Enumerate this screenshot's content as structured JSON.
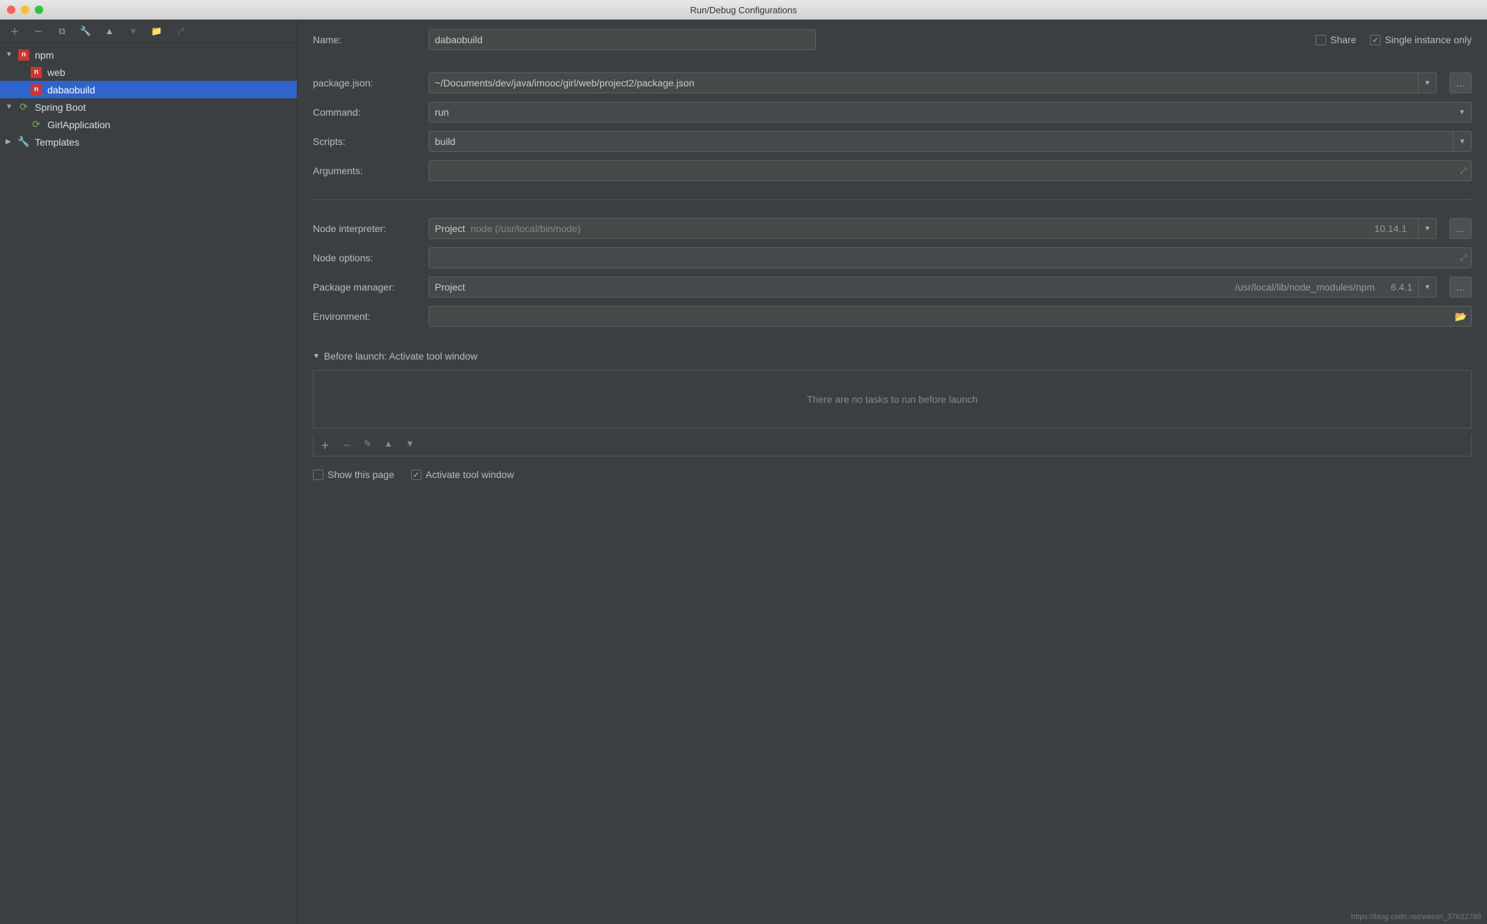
{
  "titlebar": {
    "title": "Run/Debug Configurations"
  },
  "toolbar_icons": [
    "+",
    "−"
  ],
  "tree": {
    "nodes": [
      {
        "label": "npm",
        "icon": "npm",
        "expanded": true,
        "children": [
          {
            "label": "web",
            "icon": "npm"
          },
          {
            "label": "dabaobuild",
            "icon": "npm",
            "selected": true
          }
        ]
      },
      {
        "label": "Spring Boot",
        "icon": "spring",
        "expanded": true,
        "children": [
          {
            "label": "GirlApplication",
            "icon": "spring"
          }
        ]
      },
      {
        "label": "Templates",
        "icon": "wrench",
        "expanded": false
      }
    ]
  },
  "form": {
    "name_label": "Name:",
    "name_value": "dabaobuild",
    "share_label": "Share",
    "share_checked": false,
    "single_instance_label": "Single instance only",
    "single_instance_checked": true,
    "package_json_label": "package.json:",
    "package_json_value": "~/Documents/dev/java/imooc/girl/web/project2/package.json",
    "command_label": "Command:",
    "command_value": "run",
    "scripts_label": "Scripts:",
    "scripts_value": "build",
    "arguments_label": "Arguments:",
    "arguments_value": "",
    "node_interpreter_label": "Node interpreter:",
    "node_interpreter_prefix": "Project",
    "node_interpreter_path": "node (/usr/local/bin/node)",
    "node_interpreter_version": "10.14.1",
    "node_options_label": "Node options:",
    "node_options_value": "",
    "package_manager_label": "Package manager:",
    "package_manager_prefix": "Project",
    "package_manager_path": "/usr/local/lib/node_modules/npm",
    "package_manager_version": "6.4.1",
    "environment_label": "Environment:",
    "environment_value": ""
  },
  "before_launch": {
    "header": "Before launch: Activate tool window",
    "empty_text": "There are no tasks to run before launch",
    "show_this_page_label": "Show this page",
    "show_this_page_checked": false,
    "activate_tool_window_label": "Activate tool window",
    "activate_tool_window_checked": true
  },
  "watermark": "https://blog.csdn.net/weixin_37622786"
}
